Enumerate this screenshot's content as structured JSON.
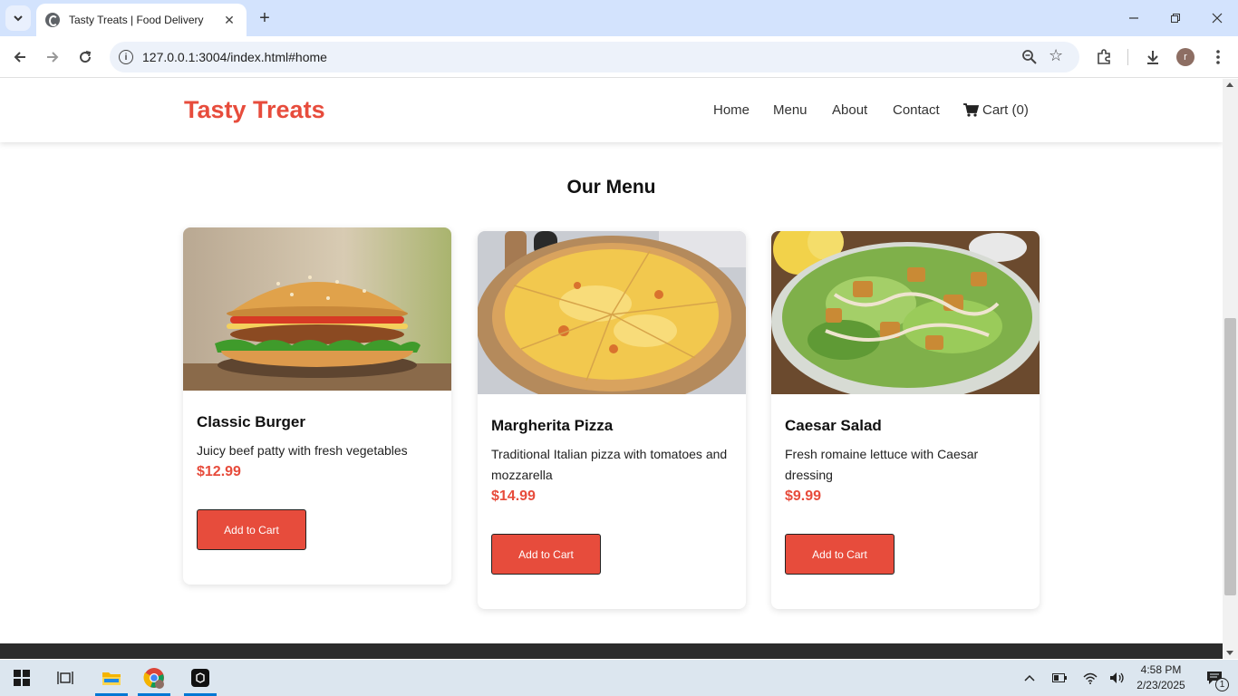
{
  "browser": {
    "tab_title": "Tasty Treats | Food Delivery",
    "url": "127.0.0.1:3004/index.html#home",
    "profile_initial": "r"
  },
  "site": {
    "logo": "Tasty Treats",
    "nav": [
      "Home",
      "Menu",
      "About",
      "Contact"
    ],
    "cart_label": "Cart (0)",
    "accent_color": "#e74c3c"
  },
  "menu": {
    "title": "Our Menu",
    "items": [
      {
        "name": "Classic Burger",
        "description": "Juicy beef patty with fresh vegetables",
        "price": "$12.99",
        "button": "Add to Cart",
        "image": "burger"
      },
      {
        "name": "Margherita Pizza",
        "description": "Traditional Italian pizza with tomatoes and mozzarella",
        "price": "$14.99",
        "button": "Add to Cart",
        "image": "pizza"
      },
      {
        "name": "Caesar Salad",
        "description": "Fresh romaine lettuce with Caesar dressing",
        "price": "$9.99",
        "button": "Add to Cart",
        "image": "salad"
      }
    ]
  },
  "taskbar": {
    "time": "4:58 PM",
    "date": "2/23/2025",
    "notification_count": "1"
  }
}
